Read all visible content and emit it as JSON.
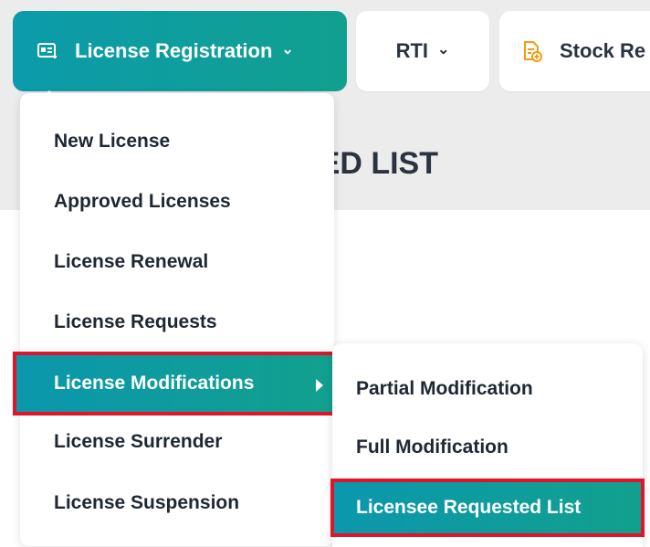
{
  "nav": {
    "tabs": [
      {
        "label": "License Registration",
        "icon": "id-card-icon"
      },
      {
        "label": "RTI"
      },
      {
        "label": "Stock Re",
        "icon": "document-add-icon"
      }
    ]
  },
  "page": {
    "heading_visible": "ED LIST"
  },
  "menu": {
    "items": [
      {
        "label": "New License"
      },
      {
        "label": "Approved Licenses"
      },
      {
        "label": "License Renewal"
      },
      {
        "label": "License Requests"
      },
      {
        "label": "License Modifications",
        "active": true
      },
      {
        "label": "License Surrender"
      },
      {
        "label": "License Suspension"
      }
    ]
  },
  "submenu": {
    "items": [
      {
        "label": "Partial Modification"
      },
      {
        "label": "Full Modification"
      },
      {
        "label": "Licensee Requested List",
        "active": true
      }
    ]
  },
  "colors": {
    "accent_start": "#0b97ad",
    "accent_end": "#12a08d",
    "highlight_outline": "#e0152a",
    "icon_orange": "#f39c12"
  }
}
